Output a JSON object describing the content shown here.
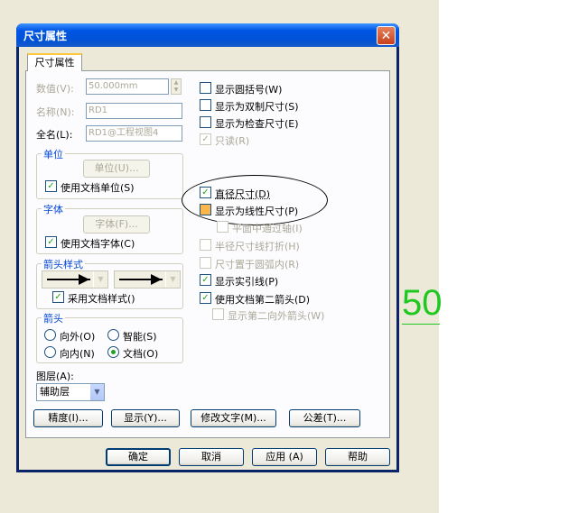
{
  "dialog": {
    "title": "尺寸属性",
    "close_glyph": "✕"
  },
  "tab": {
    "label": "尺寸属性"
  },
  "fields": {
    "value": {
      "label": "数值(V):",
      "value": "50.000mm"
    },
    "name": {
      "label": "名称(N):",
      "value": "RD1"
    },
    "fullname": {
      "label": "全名(L):",
      "value": "RD1@工程视图4"
    }
  },
  "unit_group": {
    "title": "单位",
    "button": "单位(U)...",
    "check": "使用文档单位(S)"
  },
  "font_group": {
    "title": "字体",
    "button": "字体(F)...",
    "check": "使用文档字体(C)"
  },
  "arrowstyle_group": {
    "title": "箭头样式",
    "check": "采用文档样式()"
  },
  "arrow_group": {
    "title": "箭头",
    "out": "向外(O)",
    "smart": "智能(S)",
    "in": "向内(N)",
    "doc": "文档(O)"
  },
  "layer": {
    "label": "图层(A):",
    "value": "辅助层"
  },
  "options": {
    "paren": "显示圆括号(W)",
    "dual": "显示为双制尺寸(S)",
    "inspect": "显示为检查尺寸(E)",
    "readonly": "只读(R)",
    "diameter": "直径尺寸(D)",
    "linear": "显示为线性尺寸(P)",
    "plane_axis": "平面中通过轴(I)",
    "radius_break": "半径尺寸线打折(H)",
    "in_arc": "尺寸置于圆弧内(R)",
    "solid_leader": "显示实引线(P)",
    "second_arrow": "使用文档第二箭头(D)",
    "second_out": "显示第二向外箭头(W)"
  },
  "buttons": {
    "precision": "精度(I)...",
    "display": "显示(Y)...",
    "modify_text": "修改文字(M)...",
    "tolerance": "公差(T)...",
    "ok": "确定",
    "cancel": "取消",
    "apply": "应用 (A)",
    "help": "帮助"
  },
  "canvas": {
    "dimension_text": "50"
  },
  "colors": {
    "accent": "#0046d5",
    "check": "#21a121",
    "canvas_dim": "#1ec81e"
  }
}
